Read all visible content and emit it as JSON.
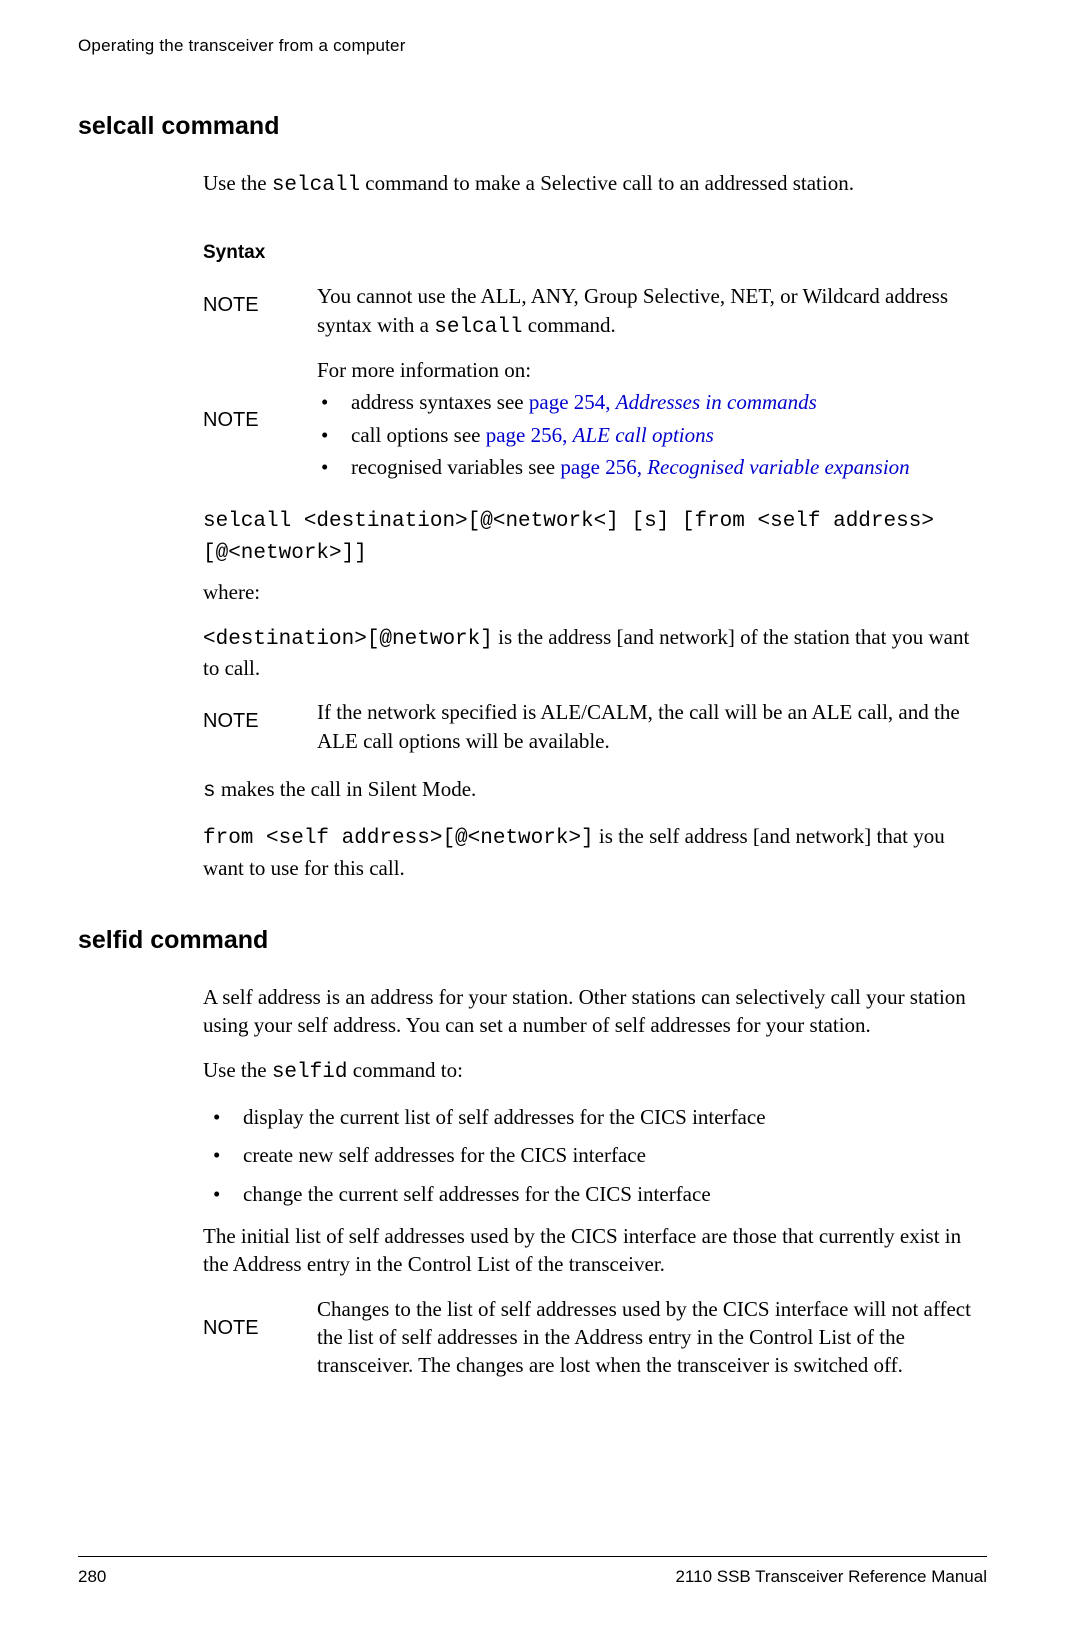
{
  "header": {
    "running_title": "Operating the transceiver from a computer"
  },
  "sections": {
    "s1": {
      "title": "selcall command",
      "intro_pre": "Use the ",
      "intro_code": "selcall",
      "intro_post": " command to make a Selective call to an addressed station.",
      "syntax_label": "Syntax"
    },
    "s2": {
      "title": "selfid command",
      "p1": "A self address is an address for your station. Other stations can selectively call your station using your self address. You can set a number of self addresses for your station.",
      "p2_pre": "Use the ",
      "p2_code": "selfid",
      "p2_post": " command to:",
      "bullets": {
        "b1": "display the current list of self addresses for the CICS interface",
        "b2": "create new self addresses for the CICS interface",
        "b3": "change the current self addresses for the CICS interface"
      },
      "p3": "The initial list of self addresses used by the CICS interface are those that currently exist in the Address entry in the Control List of the transceiver."
    }
  },
  "notes": {
    "label": "NOTE",
    "n1": {
      "pre": "You cannot use the ALL, ANY, Group Selective, NET, or Wildcard address syntax with a ",
      "code": "selcall",
      "post": " command."
    },
    "n2": {
      "intro": "For more information on:",
      "items": {
        "i1_pre": "address syntaxes see ",
        "i1_link1": "page 254, ",
        "i1_link2": "Addresses in commands",
        "i2_pre": "call options see ",
        "i2_link1": "page 256, ",
        "i2_link2": "ALE call options",
        "i3_pre": "recognised variables see ",
        "i3_link1": "page 256, ",
        "i3_link2": "Recognised variable expansion"
      }
    },
    "n3": "If the network specified is ALE/CALM, the call will be an ALE call, and the ALE call options will be available.",
    "n4": "Changes to the list of self addresses used by the CICS interface will not affect the list of self addresses in the Address entry in the Control List of the transceiver. The changes are lost when the transceiver is switched off."
  },
  "syntax": {
    "cmd": "selcall <destination>[@<network<] [s] [from <self address>[@<network>]]",
    "where": "where:",
    "dest_code": "<destination>[@network]",
    "dest_post": " is the address [and network] of the station that you want to call.",
    "s_code": "s",
    "s_post": " makes the call in Silent Mode.",
    "from_code": "from <self address>[@<network>]",
    "from_post": " is the self address [and network] that you want to use for this call."
  },
  "footer": {
    "page": "280",
    "title": "2110 SSB Transceiver Reference Manual"
  }
}
